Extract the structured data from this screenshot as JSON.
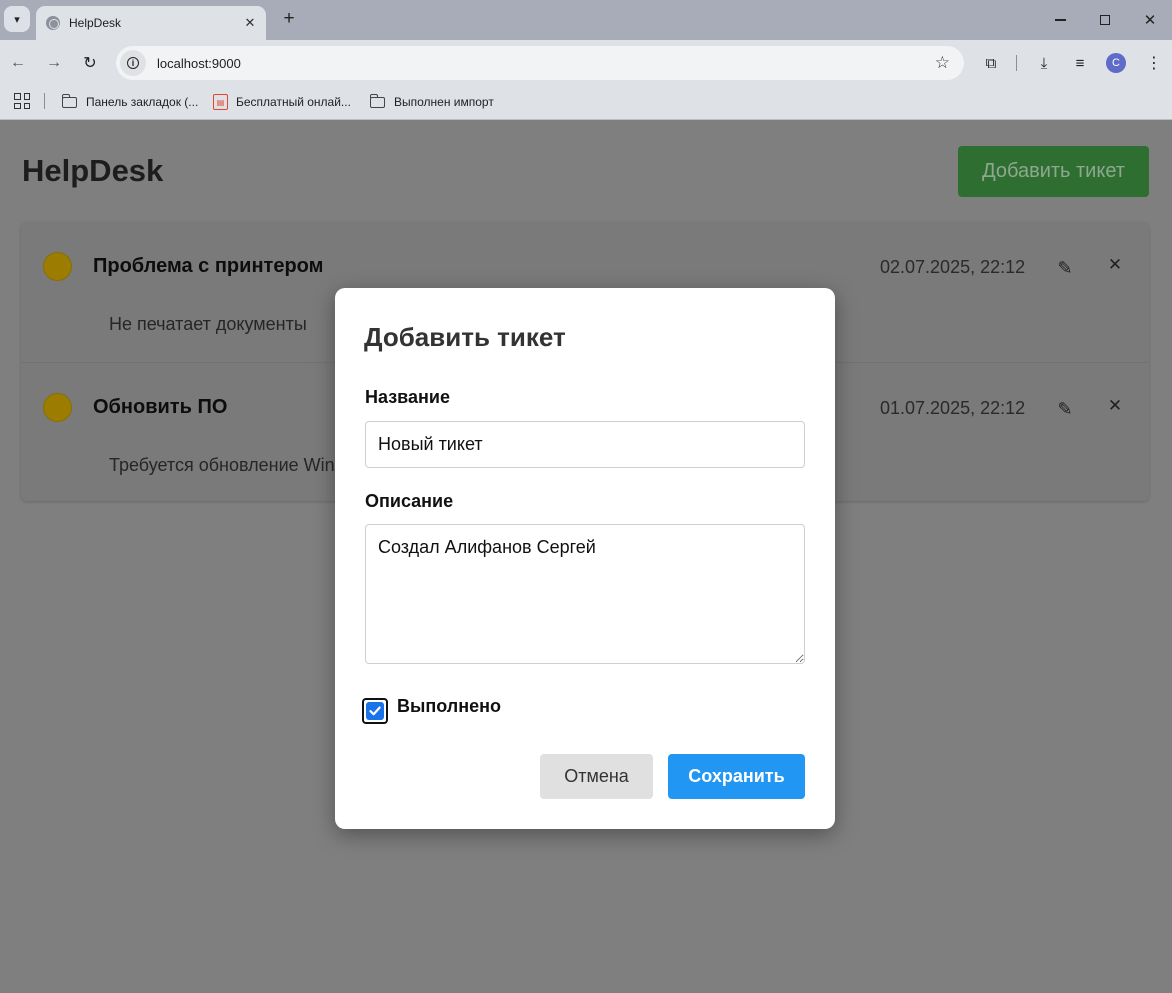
{
  "browser": {
    "tab": {
      "title": "HelpDesk",
      "favicon": "globe-icon",
      "close_glyph": "✕"
    },
    "new_tab_glyph": "+",
    "address": {
      "url": "localhost:9000"
    },
    "profile_initial": "C",
    "bookmarks": [
      {
        "label": "Панель закладок (...",
        "icon": "folder-icon"
      },
      {
        "label": "Бесплатный онлай...",
        "icon": "pdf-icon"
      },
      {
        "label": "Выполнен импорт",
        "icon": "folder-icon"
      }
    ]
  },
  "app": {
    "title": "HelpDesk",
    "add_button_label": "Добавить тикет"
  },
  "tickets": [
    {
      "title": "Проблема с принтером",
      "date": "02.07.2025, 22:12",
      "description": "Не печатает документы",
      "status_color": "#c7a000"
    },
    {
      "title": "Обновить ПО",
      "date": "01.07.2025, 22:12",
      "description": "Требуется обновление Win",
      "status_color": "#c7a000"
    }
  ],
  "modal": {
    "title": "Добавить тикет",
    "name_label": "Название",
    "name_value": "Новый тикет",
    "desc_label": "Описание",
    "desc_value": "Создал Алифанов Сергей",
    "done_label": "Выполнено",
    "done_checked": true,
    "cancel_label": "Отмена",
    "save_label": "Сохранить"
  },
  "colors": {
    "save_button": "#2196f3",
    "add_button": "#2f6e31",
    "checkbox": "#1a73e8"
  }
}
